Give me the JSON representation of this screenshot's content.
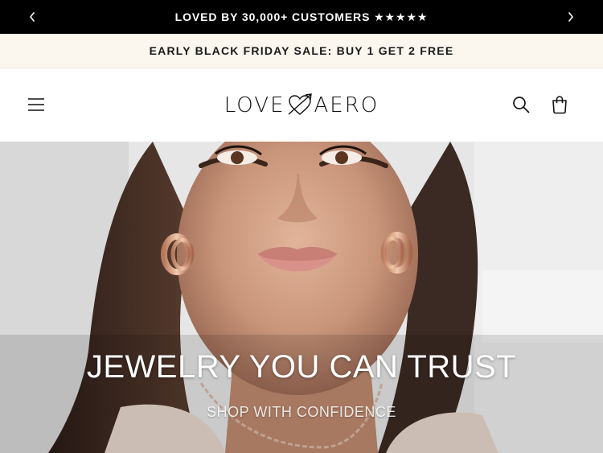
{
  "announcement": {
    "text": "LOVED BY 30,000+ CUSTOMERS ★★★★★",
    "prev_icon": "chevron-left-icon",
    "next_icon": "chevron-right-icon"
  },
  "promo": {
    "text": "EARLY BLACK FRIDAY SALE: BUY 1 GET 2 FREE"
  },
  "header": {
    "logo_left": "LOVE",
    "logo_right": "AERO",
    "menu_icon": "hamburger-menu-icon",
    "search_icon": "search-icon",
    "cart_icon": "shopping-bag-icon"
  },
  "hero": {
    "title": "JEWELRY YOU CAN TRUST",
    "subtitle": "SHOP WITH CONFIDENCE"
  },
  "colors": {
    "announcement_bg": "#000000",
    "promo_bg": "#fbf7ef",
    "text": "#111111"
  }
}
